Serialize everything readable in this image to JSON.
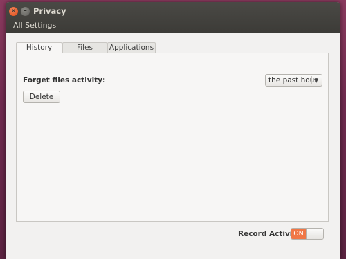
{
  "window": {
    "title": "Privacy"
  },
  "header": {
    "all_settings_label": "All Settings"
  },
  "window_controls": {
    "close_glyph": "×",
    "minimize_glyph": "–"
  },
  "tabs": [
    {
      "label": "History",
      "active": true
    },
    {
      "label": "Files",
      "active": false
    },
    {
      "label": "Applications",
      "active": false
    }
  ],
  "history": {
    "forget_label": "Forget files activity:",
    "delete_label": "Delete",
    "period_selected": "the past hour",
    "dropdown_icon": "chevron-down-icon"
  },
  "footer": {
    "record_label": "Record Activity",
    "toggle_state": "ON"
  },
  "colors": {
    "accent": "#f07746",
    "titlebar": "#3c3b37",
    "close_button": "#dd4814"
  }
}
